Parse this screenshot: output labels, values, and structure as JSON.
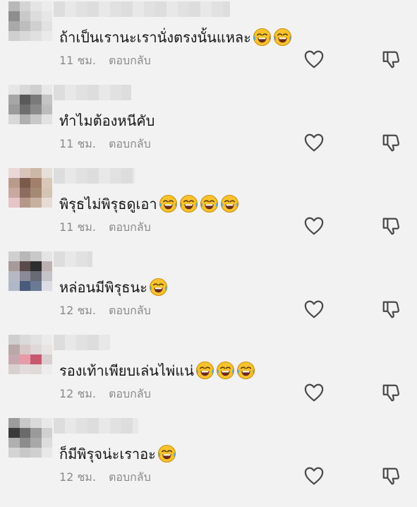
{
  "comments": [
    {
      "text": "ถ้าเป็นเรานะเรานั่งตรงนั้นแหละ",
      "emoji_count": 2,
      "time": "11 ชม.",
      "reply": "ตอบกลับ",
      "avatar_colors": [
        "#b8b8b8",
        "#d4d4d4",
        "#e4e4e4",
        "#ececec",
        "#8e8e8e",
        "#c9c9c9",
        "#dcdcdc",
        "#e6e6e6",
        "#a9a9a9",
        "#bdbdbd",
        "#d0d0d0",
        "#e2e2e2",
        "#cfcfcf",
        "#d8d8d8",
        "#e0e0e0",
        "#eaeaea"
      ],
      "name_width": 250
    },
    {
      "text": "ทำไมต้องหนีคับ",
      "emoji_count": 0,
      "time": "11 ชม.",
      "reply": "ตอบกลับ",
      "avatar_colors": [
        "#e6e6e6",
        "#d9d9d9",
        "#cfcfcf",
        "#e8e8e8",
        "#a6a6a6",
        "#5a5a5a",
        "#7a7a7a",
        "#c4c4c4",
        "#9b9b9b",
        "#6e6e6e",
        "#8a8a8a",
        "#bcbcbc",
        "#d8d8d8",
        "#b0b0b0",
        "#c8c8c8",
        "#e2e2e2"
      ],
      "name_width": 110
    },
    {
      "text": "พิรุธไม่พิรุธดูเอา",
      "emoji_count": 4,
      "time": "11 ชม.",
      "reply": "ตอบกลับ",
      "avatar_colors": [
        "#ead8d8",
        "#d9c4bb",
        "#cdb8a6",
        "#e6e0da",
        "#b99b8c",
        "#7a5a4a",
        "#a08068",
        "#d8c8b8",
        "#c8a8a0",
        "#8d6c60",
        "#a48a74",
        "#d4c4b4",
        "#e6c4c8",
        "#b49888",
        "#c8b0a0",
        "#e6dcd4"
      ],
      "name_width": 115
    },
    {
      "text": "หล่อนมีพิรุธนะ",
      "emoji_count": 1,
      "time": "12 ชม.",
      "reply": "ตอบกลับ",
      "avatar_colors": [
        "#d0d0d0",
        "#b8b8b8",
        "#c8c8c8",
        "#e4e4e4",
        "#a89a9a",
        "#5a4a4a",
        "#2e2e2e",
        "#bdb0b0",
        "#b8b8c4",
        "#8a8a98",
        "#6a6a74",
        "#c4c4c8",
        "#b0b8c8",
        "#4a5a7a",
        "#6a7a94",
        "#dcdce2"
      ],
      "name_width": 55
    },
    {
      "text": "รองเท้าเพียบเล่นไพ่แน่",
      "emoji_count": 3,
      "time": "12 ชม.",
      "reply": "ตอบกลับ",
      "avatar_colors": [
        "#cfcfcf",
        "#dadada",
        "#e2e2e2",
        "#ebebeb",
        "#b8a8a8",
        "#d8c8c8",
        "#e0d8d8",
        "#e8e4e4",
        "#c8a8b0",
        "#e89aa8",
        "#c85870",
        "#d8d0d0",
        "#d8d0d0",
        "#e4dcdc",
        "#e0dada",
        "#ececec"
      ],
      "name_width": 80
    },
    {
      "text": "ก็มีพิรุจน่ะเราอะ",
      "emoji_count": 1,
      "time": "12 ชม.",
      "reply": "ตอบกลับ",
      "avatar_colors": [
        "#9c9c9c",
        "#c8c8c8",
        "#dadada",
        "#e8e8e8",
        "#3a3a3a",
        "#6a6a6a",
        "#9a9a9a",
        "#d0d0d0",
        "#b0b0b0",
        "#8c8c8c",
        "#a8a8a8",
        "#dcdcdc",
        "#d4d4d4",
        "#c8c8c8",
        "#d0d0d0",
        "#e8e8e8"
      ],
      "name_width": 120
    }
  ],
  "icons": {
    "like": "heart-outline-icon",
    "dislike": "thumbs-down-outline-icon",
    "emoji": "face-with-tears-of-joy-icon"
  },
  "colors": {
    "background": "#f2f2f2",
    "text": "#161616",
    "meta": "#8a8a8a",
    "icon": "#4a4a4a",
    "emoji_face": "#f7c22b"
  }
}
